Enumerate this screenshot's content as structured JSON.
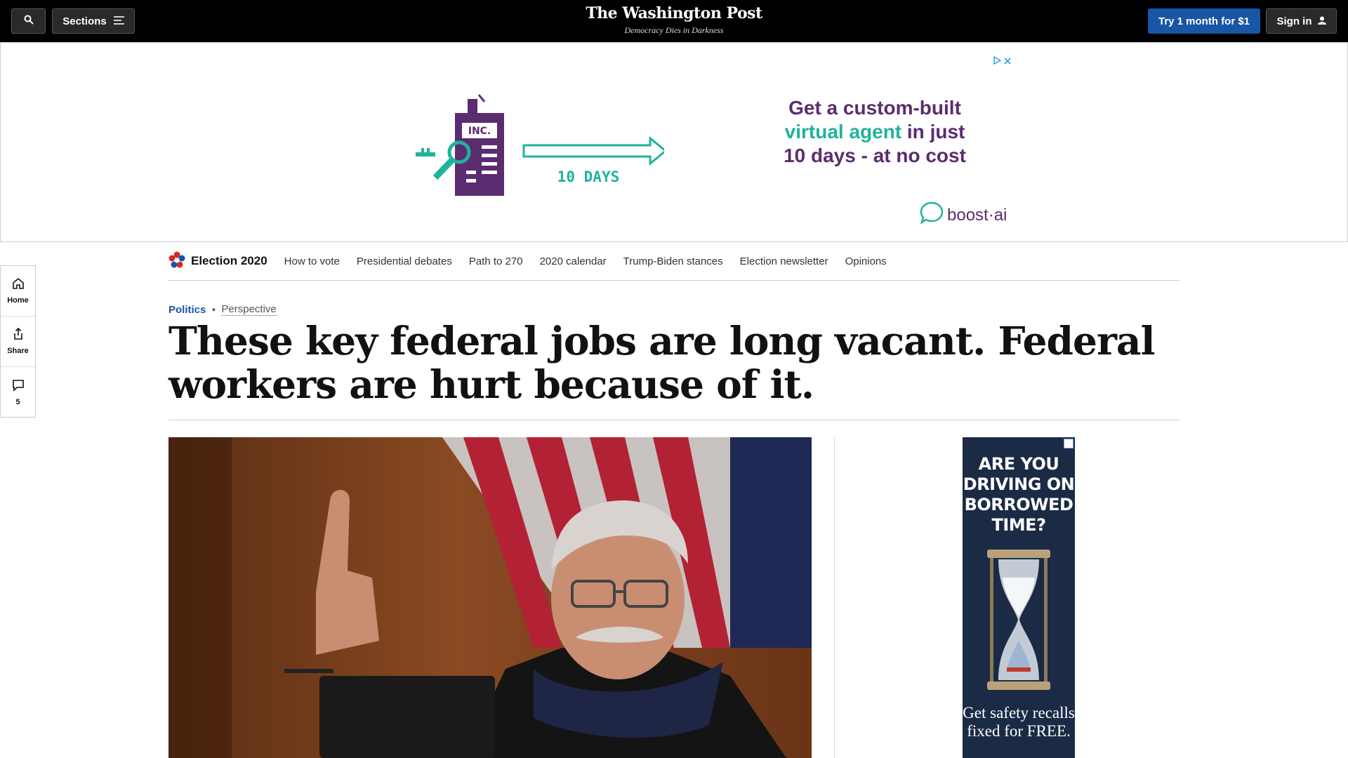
{
  "header": {
    "sections_label": "Sections",
    "brand": "The Washington Post",
    "tagline": "Democracy Dies in Darkness",
    "subscribe_label": "Try 1 month for $1",
    "signin_label": "Sign in"
  },
  "banner_ad": {
    "graphic_sign": "INC.",
    "graphic_days": "10 DAYS",
    "line1": "Get a custom-built",
    "line2_highlight": "virtual agent",
    "line2_rest": " in just",
    "line3": "10 days - at no cost",
    "advertiser": "boost·ai",
    "colors": {
      "purple": "#5b2c6f",
      "teal": "#1fb39b"
    }
  },
  "election_nav": {
    "title": "Election 2020",
    "links": [
      "How to vote",
      "Presidential debates",
      "Path to 270",
      "2020 calendar",
      "Trump-Biden stances",
      "Election newsletter",
      "Opinions"
    ]
  },
  "left_rail": {
    "home_label": "Home",
    "share_label": "Share",
    "comment_count": "5"
  },
  "article": {
    "section": "Politics",
    "label": "Perspective",
    "headline": "These key federal jobs are long vacant. Federal workers are hurt because of it."
  },
  "side_ad": {
    "headline": "ARE YOU DRIVING ON BORROWED TIME?",
    "body": "Get safety recalls fixed for FREE."
  },
  "colors": {
    "header_bg": "#000000",
    "subscribe_blue": "#1955a5",
    "section_blue": "#1955a5"
  }
}
